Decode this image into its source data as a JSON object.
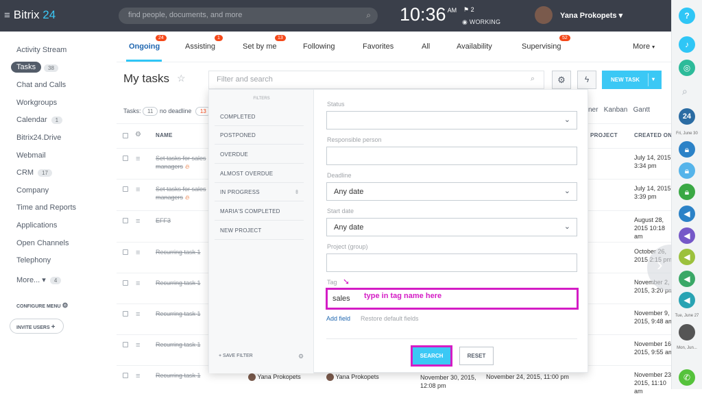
{
  "topbar": {
    "logo_prefix": "Bitrix",
    "logo_number": "24",
    "search_placeholder": "find people, documents, and more",
    "time": "10:36",
    "ampm": "AM",
    "flag_count": "2",
    "status": "WORKING",
    "user_name": "Yana Prokopets"
  },
  "sidebar": {
    "items": [
      {
        "label": "Activity Stream",
        "count": ""
      },
      {
        "label": "Tasks",
        "count": "38"
      },
      {
        "label": "Chat and Calls",
        "count": ""
      },
      {
        "label": "Workgroups",
        "count": ""
      },
      {
        "label": "Calendar",
        "count": "1"
      },
      {
        "label": "Bitrix24.Drive",
        "count": ""
      },
      {
        "label": "Webmail",
        "count": ""
      },
      {
        "label": "CRM",
        "count": "17"
      },
      {
        "label": "Company",
        "count": ""
      },
      {
        "label": "Time and Reports",
        "count": ""
      },
      {
        "label": "Applications",
        "count": ""
      },
      {
        "label": "Open Channels",
        "count": ""
      },
      {
        "label": "Telephony",
        "count": ""
      },
      {
        "label": "More...",
        "count": "4"
      }
    ],
    "configure": "CONFIGURE MENU",
    "invite": "INVITE USERS"
  },
  "tabs": [
    {
      "label": "Ongoing",
      "badge": "24"
    },
    {
      "label": "Assisting",
      "badge": "1"
    },
    {
      "label": "Set by me",
      "badge": "13"
    },
    {
      "label": "Following",
      "badge": ""
    },
    {
      "label": "Favorites",
      "badge": ""
    },
    {
      "label": "All",
      "badge": ""
    },
    {
      "label": "Availability",
      "badge": ""
    },
    {
      "label": "Supervising",
      "badge": "52"
    },
    {
      "label": "More",
      "badge": ""
    }
  ],
  "main": {
    "title": "My tasks",
    "filter_placeholder": "Filter and search",
    "new_task": "NEW TASK",
    "tasks_label": "Tasks:",
    "tasks_count": "11",
    "no_deadline": "no deadline",
    "no_deadline_count": "13",
    "views": "ner   Kanban   Gantt",
    "col_name": "NAME",
    "col_project": "PROJECT",
    "col_created": "CREATED ON"
  },
  "rows": [
    {
      "name": "Set tasks for sales managers",
      "created": "July 14, 2015 3:34 pm",
      "fire": true
    },
    {
      "name": "Set tasks for sales managers",
      "created": "July 14, 2015 3:39 pm",
      "fire": true
    },
    {
      "name": "EFF3",
      "created": "August 28, 2015 10:18 am",
      "fire": false
    },
    {
      "name": "Recurring task 1",
      "created": "October 26, 2015 2:15 pm",
      "fire": false
    },
    {
      "name": "Recurring task 1",
      "created": "November 2, 2015, 3:20 pm",
      "fire": false
    },
    {
      "name": "Recurring task 1",
      "created": "November 9, 2015, 9:48 am",
      "fire": false
    },
    {
      "name": "Recurring task 1",
      "created": "November 16, 2015, 9:55 am",
      "fire": false
    },
    {
      "name": "Recurring task 1",
      "created": "November 23, 2015, 11:10 am",
      "fire": false
    }
  ],
  "bottom_row": {
    "creator": "Yana Prokopets",
    "responsible": "Yana Prokopets",
    "date1": "November 30, 2015, 12:08 pm",
    "date2": "November 24, 2015, 11:00 pm"
  },
  "filter_panel": {
    "heading": "FILTERS",
    "presets": [
      "COMPLETED",
      "POSTPONED",
      "OVERDUE",
      "ALMOST OVERDUE",
      "IN PROGRESS",
      "MARIA'S COMPLETED",
      "NEW PROJECT"
    ],
    "save_filter": "SAVE FILTER",
    "fields": {
      "status_label": "Status",
      "responsible_label": "Responsible person",
      "deadline_label": "Deadline",
      "deadline_value": "Any date",
      "start_label": "Start date",
      "start_value": "Any date",
      "project_label": "Project (group)",
      "tag_label": "Tag",
      "tag_value": "sales"
    },
    "annotation": "type in tag name here",
    "add_field": "Add field",
    "restore": "Restore default fields",
    "search_btn": "SEARCH",
    "reset_btn": "RESET"
  },
  "rail": {
    "date1": "Fri, June 30",
    "date2": "Tue, June 27",
    "date3": "Mon, Jun..."
  },
  "colors": {
    "accent": "#3bc8f5",
    "annotation": "#d41cc5",
    "badge": "#f54819",
    "topbar": "#3a3f4a"
  }
}
